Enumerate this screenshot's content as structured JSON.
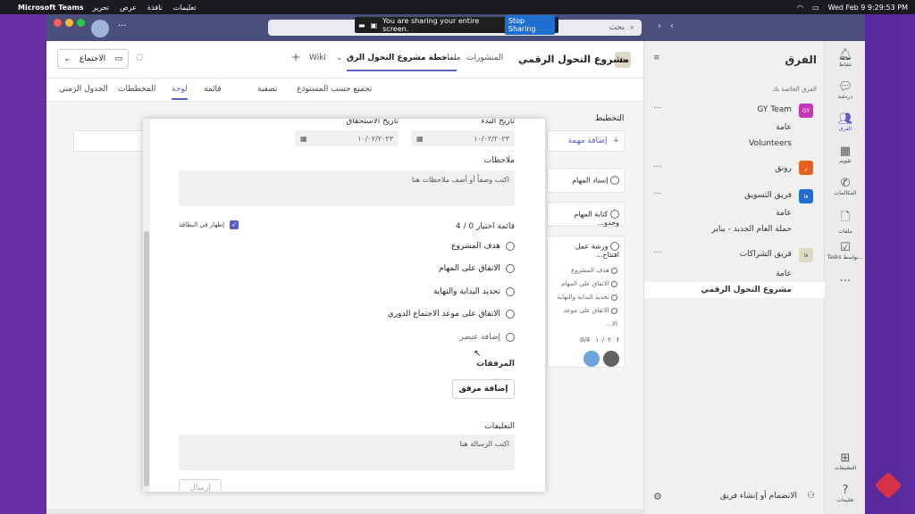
{
  "menubar": {
    "app": "Microsoft Teams",
    "menus": [
      "تحرير",
      "عرض",
      "نافذة",
      "تعليمات"
    ],
    "datetime": "Wed Feb 9  9:29:53 PM"
  },
  "sharebar": {
    "text": "You are sharing your entire screen.",
    "stop": "Stop Sharing"
  },
  "search": {
    "placeholder": "بحث"
  },
  "rail": [
    {
      "label": "نشاط",
      "icon": "bell-icon"
    },
    {
      "label": "دردشة",
      "icon": "chat-icon"
    },
    {
      "label": "الفرق",
      "icon": "teams-icon"
    },
    {
      "label": "تقويم",
      "icon": "calendar-icon"
    },
    {
      "label": "المكالمات",
      "icon": "phone-icon"
    },
    {
      "label": "ملفات",
      "icon": "file-icon"
    },
    {
      "label": "Tasks بواسط...",
      "icon": "tasks-icon"
    },
    {
      "label": "التطبيقات",
      "icon": "apps-icon"
    },
    {
      "label": "تعليمات",
      "icon": "help-icon"
    }
  ],
  "teams": {
    "title": "الفرق",
    "section": "الفرق الخاصة بك",
    "gy_team": "GY Team",
    "gy_general": "عامة",
    "volunteers": "Volunteers",
    "rawnaq": "رونق",
    "marketing": "فريق التسويق",
    "marketing_general": "عامة",
    "campaign": "حملة العام الجديد - يناير",
    "partnerships": "فريق الشراكات",
    "partnerships_general": "عامة",
    "digital": "مشروع التحول الرقمي",
    "join": "الانضمام أو إنشاء فريق",
    "avatars": {
      "gy": "GY",
      "part": "فا",
      "mkt": "فا",
      "rawnaq": "ر"
    }
  },
  "header": {
    "avatar": "فا",
    "title": "مشروع التحول الرقمي",
    "tabs": [
      "المنشورات",
      "ملفات",
      "خطة مشروع التحول الرق...",
      "Wiki"
    ],
    "meeting": "الاجتماع"
  },
  "toolbar": {
    "items": [
      "لوحة",
      "قائمة",
      "المخططات",
      "الجدول الزمني"
    ],
    "group": "تجميع حسب المستودع",
    "filter": "تصفية"
  },
  "board": {
    "column": "التخطيط",
    "add_task": "إضافة مهمة",
    "card1": "إسناد المهام",
    "card2": "كتابة المهام وجدو...",
    "card3": "ورشة عمل افتتاح...",
    "card3_items": [
      "هدف المشروع",
      "الاتفاق على المهام",
      "تحديد البداية والنهاية",
      "الاتفاق على موعد الا..."
    ],
    "card3_meta_date": "١٠/٠٢",
    "card3_meta_check": "0/4"
  },
  "dialog": {
    "start_label": "تاريخ البدء",
    "due_label": "تاريخ الاستحقاق",
    "start_value": "١٠/٠٢/٢٠٢٣",
    "due_value": "١٠/٠٢/٢٠٢٣",
    "notes_label": "ملاحظات",
    "notes_placeholder": "اكتب وصفاً أو أضف ملاحظات هنا",
    "checklist_label": "قائمة اختيار 0 / 4",
    "show_on_card": "إظهار في البطاقة",
    "checklist": [
      "هدف المشروع",
      "الاتفاق على المهام",
      "تحديد البداية والنهاية",
      "الاتفاق على موعد الاجتماع الدوري"
    ],
    "add_item": "إضافة عنصر",
    "attachments_label": "المرفقات",
    "add_attachment": "إضافة مرفق",
    "comments_label": "التعليقات",
    "comment_placeholder": "اكتب الرسالة هنا",
    "send": "إرسال"
  },
  "colors": {
    "titlebar": "#4b4f7c",
    "accent": "#5b5fc7",
    "gy": "#c239b3",
    "rawnaq": "#e8601c",
    "marketing": "#1f6fd1"
  }
}
